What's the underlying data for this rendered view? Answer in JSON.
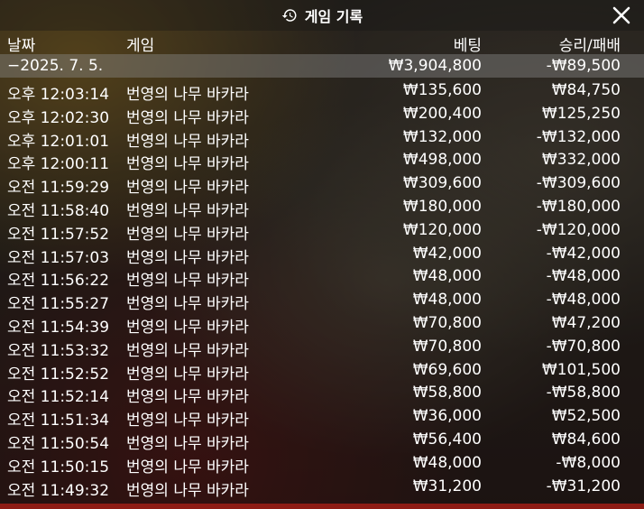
{
  "title": "게임 기록",
  "icons": {
    "history": "history-clock-icon",
    "close": "close-x-icon"
  },
  "header": {
    "date": "날짜",
    "game": "게임",
    "bet": "베팅",
    "result": "승리/패배"
  },
  "summary": {
    "date": "−2025. 7. 5.",
    "bet": "₩3,904,800",
    "result": "-₩89,500"
  },
  "rows": [
    {
      "time": "오후 12:03:14",
      "game": "번영의 나무 바카라",
      "bet": "₩135,600",
      "result": "₩84,750"
    },
    {
      "time": "오후 12:02:30",
      "game": "번영의 나무 바카라",
      "bet": "₩200,400",
      "result": "₩125,250"
    },
    {
      "time": "오후 12:01:01",
      "game": "번영의 나무 바카라",
      "bet": "₩132,000",
      "result": "-₩132,000"
    },
    {
      "time": "오후 12:00:11",
      "game": "번영의 나무 바카라",
      "bet": "₩498,000",
      "result": "₩332,000"
    },
    {
      "time": "오전 11:59:29",
      "game": "번영의 나무 바카라",
      "bet": "₩309,600",
      "result": "-₩309,600"
    },
    {
      "time": "오전 11:58:40",
      "game": "번영의 나무 바카라",
      "bet": "₩180,000",
      "result": "-₩180,000"
    },
    {
      "time": "오전 11:57:52",
      "game": "번영의 나무 바카라",
      "bet": "₩120,000",
      "result": "-₩120,000"
    },
    {
      "time": "오전 11:57:03",
      "game": "번영의 나무 바카라",
      "bet": "₩42,000",
      "result": "-₩42,000"
    },
    {
      "time": "오전 11:56:22",
      "game": "번영의 나무 바카라",
      "bet": "₩48,000",
      "result": "-₩48,000"
    },
    {
      "time": "오전 11:55:27",
      "game": "번영의 나무 바카라",
      "bet": "₩48,000",
      "result": "-₩48,000"
    },
    {
      "time": "오전 11:54:39",
      "game": "번영의 나무 바카라",
      "bet": "₩70,800",
      "result": "₩47,200"
    },
    {
      "time": "오전 11:53:32",
      "game": "번영의 나무 바카라",
      "bet": "₩70,800",
      "result": "-₩70,800"
    },
    {
      "time": "오전 11:52:52",
      "game": "번영의 나무 바카라",
      "bet": "₩69,600",
      "result": "₩101,500"
    },
    {
      "time": "오전 11:52:14",
      "game": "번영의 나무 바카라",
      "bet": "₩58,800",
      "result": "-₩58,800"
    },
    {
      "time": "오전 11:51:34",
      "game": "번영의 나무 바카라",
      "bet": "₩36,000",
      "result": "₩52,500"
    },
    {
      "time": "오전 11:50:54",
      "game": "번영의 나무 바카라",
      "bet": "₩56,400",
      "result": "₩84,600"
    },
    {
      "time": "오전 11:50:15",
      "game": "번영의 나무 바카라",
      "bet": "₩48,000",
      "result": "-₩8,000"
    },
    {
      "time": "오전 11:49:32",
      "game": "번영의 나무 바카라",
      "bet": "₩31,200",
      "result": "-₩31,200"
    }
  ]
}
